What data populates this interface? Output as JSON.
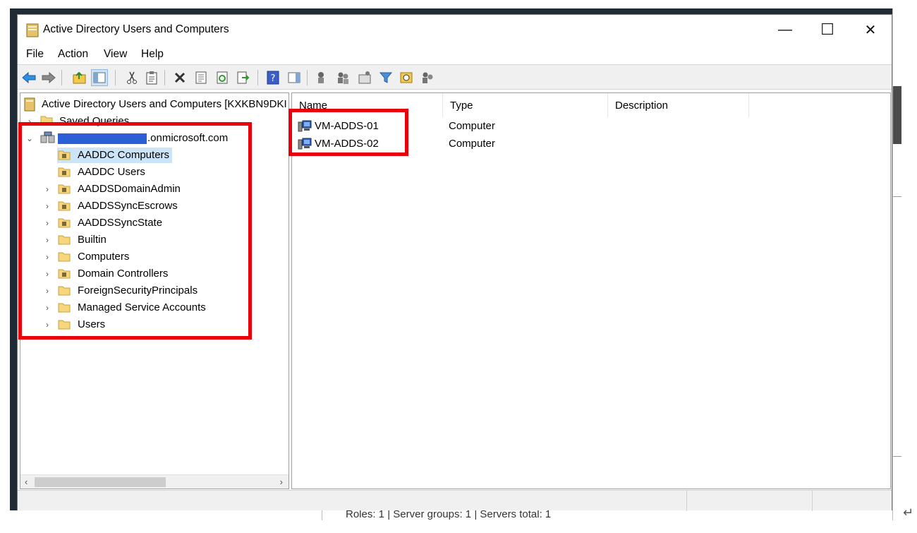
{
  "window": {
    "title": "Active Directory Users and Computers",
    "minimize_glyph": "—",
    "maximize_glyph": "☐",
    "close_glyph": "✕"
  },
  "menu": [
    "File",
    "Action",
    "View",
    "Help"
  ],
  "toolbar_icons": [
    "back-arrow-icon",
    "forward-arrow-icon",
    "up-folder-icon",
    "show-hide-console-tree-icon",
    "cut-icon",
    "paste-icon",
    "delete-icon",
    "properties-icon",
    "refresh-icon",
    "export-list-icon",
    "help-icon",
    "show-action-pane-icon",
    "users-icon",
    "groups-icon",
    "organizational-unit-icon",
    "filter-icon",
    "find-icon",
    "add-to-group-icon"
  ],
  "tree": {
    "root_label": "Active Directory Users and Computers [KXKBN9DKI",
    "saved_queries": "Saved Queries",
    "domain_suffix": ".onmicrosoft.com",
    "items": [
      {
        "label": "AADDC Computers",
        "selected": true,
        "expandable": false
      },
      {
        "label": "AADDC Users",
        "selected": false,
        "expandable": false
      },
      {
        "label": "AADDSDomainAdmin",
        "selected": false,
        "expandable": true
      },
      {
        "label": "AADDSSyncEscrows",
        "selected": false,
        "expandable": true
      },
      {
        "label": "AADDSSyncState",
        "selected": false,
        "expandable": true
      },
      {
        "label": "Builtin",
        "selected": false,
        "expandable": true
      },
      {
        "label": "Computers",
        "selected": false,
        "expandable": true
      },
      {
        "label": "Domain Controllers",
        "selected": false,
        "expandable": true
      },
      {
        "label": "ForeignSecurityPrincipals",
        "selected": false,
        "expandable": true
      },
      {
        "label": "Managed Service Accounts",
        "selected": false,
        "expandable": true
      },
      {
        "label": "Users",
        "selected": false,
        "expandable": true
      }
    ]
  },
  "list": {
    "columns": [
      "Name",
      "Type",
      "Description"
    ],
    "rows": [
      {
        "name": "VM-ADDS-01",
        "type": "Computer"
      },
      {
        "name": "VM-ADDS-02",
        "type": "Computer"
      }
    ]
  },
  "behind_window": {
    "status_text": "Roles: 1   |   Server groups: 1   |   Servers total: 1"
  },
  "colors": {
    "highlight_box": "#e8000b",
    "selection": "#cce4f7",
    "redaction": "#2a5fd6"
  }
}
